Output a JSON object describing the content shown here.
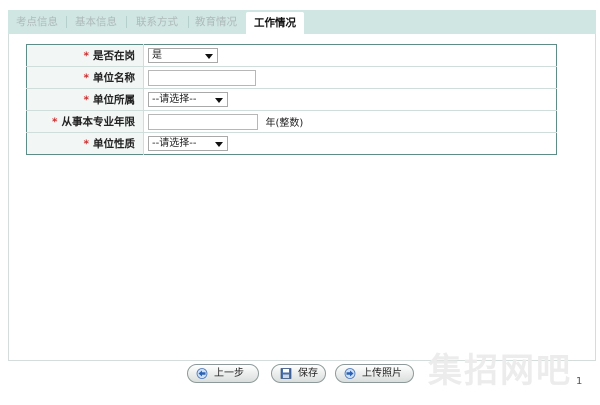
{
  "tabs": [
    {
      "label": "考点信息",
      "active": false
    },
    {
      "label": "基本信息",
      "active": false
    },
    {
      "label": "联系方式",
      "active": false
    },
    {
      "label": "教育情况",
      "active": false
    },
    {
      "label": "工作情况",
      "active": true
    }
  ],
  "form": {
    "required_mark": "*",
    "fields": [
      {
        "label": "是否在岗",
        "type": "select",
        "value": "是"
      },
      {
        "label": "单位名称",
        "type": "text",
        "value": ""
      },
      {
        "label": "单位所属",
        "type": "select",
        "value": "--请选择--"
      },
      {
        "label": "从事本专业年限",
        "type": "text",
        "value": "",
        "hint": "年(整数)"
      },
      {
        "label": "单位性质",
        "type": "select",
        "value": "--请选择--"
      }
    ]
  },
  "buttons": {
    "prev_label": "上一步",
    "save_label": "保存",
    "upload_label": "上传照片"
  },
  "watermark": {
    "text": "集招网吧"
  },
  "page_number": "1",
  "colors": {
    "tab_bar": "#cfe6e3",
    "table_border": "#5e8d87",
    "required": "#c81414",
    "label_bg": "#f2f6f5"
  }
}
